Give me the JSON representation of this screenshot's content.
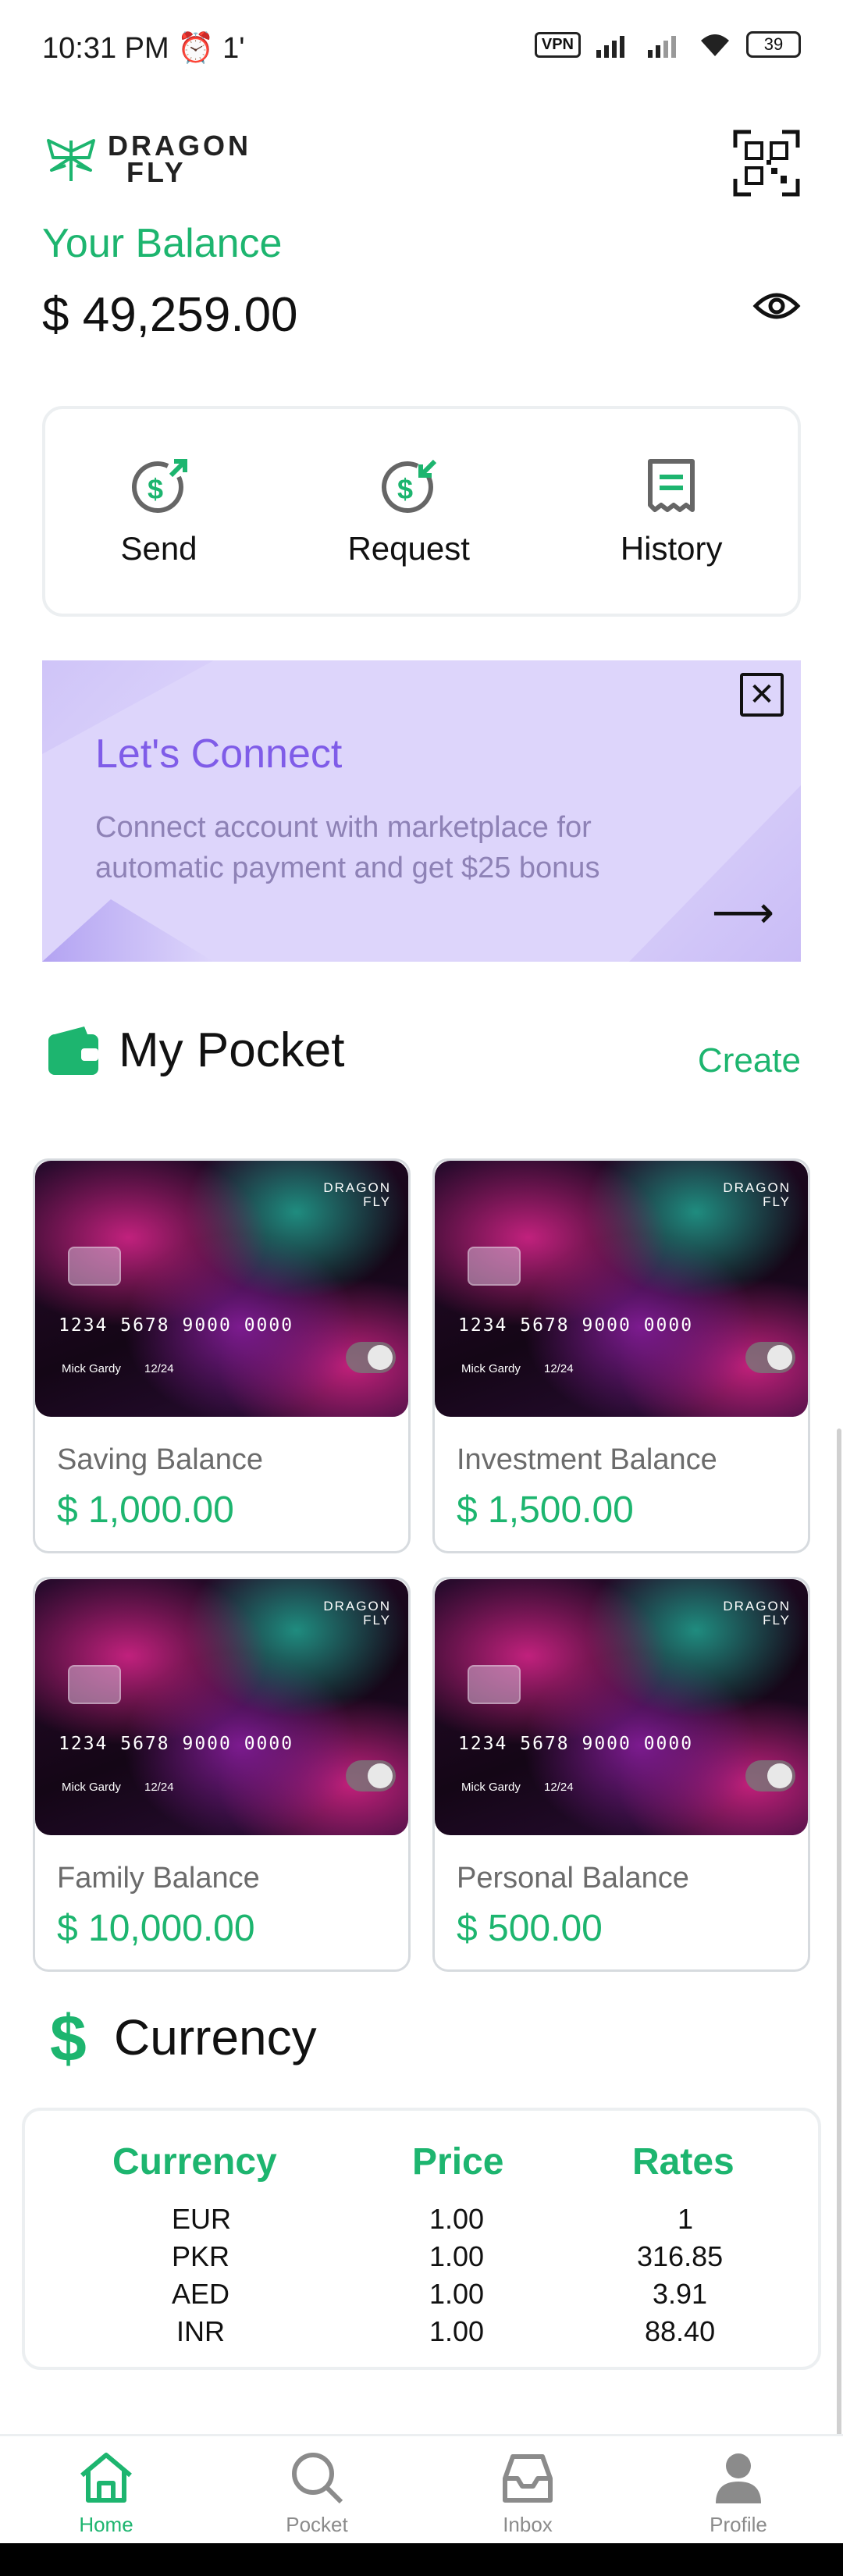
{
  "status": {
    "time": "10:31 PM",
    "extra": "1'",
    "vpn": "VPN",
    "battery": "39"
  },
  "brand": {
    "line1": "DRAGON",
    "line2": "FLY"
  },
  "balance": {
    "label": "Your Balance",
    "amount": "$ 49,259.00"
  },
  "actions": [
    {
      "label": "Send",
      "icon": "send-money-icon"
    },
    {
      "label": "Request",
      "icon": "request-money-icon"
    },
    {
      "label": "History",
      "icon": "receipt-icon"
    }
  ],
  "promo": {
    "title": "Let's Connect",
    "body": "Connect account with marketplace for automatic payment and get $25 bonus"
  },
  "pocket": {
    "title": "My Pocket",
    "create": "Create",
    "cards": [
      {
        "name": "Saving Balance",
        "amount": "$ 1,000.00"
      },
      {
        "name": "Investment Balance",
        "amount": "$ 1,500.00"
      },
      {
        "name": "Family Balance",
        "amount": "$ 10,000.00"
      },
      {
        "name": "Personal Balance",
        "amount": "$ 500.00"
      }
    ],
    "card_face": {
      "brand1": "DRAGON",
      "brand2": "FLY",
      "number": "1234 5678 9000 0000",
      "holder": "Mick Gardy",
      "expiry": "12/24"
    }
  },
  "currency": {
    "title": "Currency",
    "headers": [
      "Currency",
      "Price",
      "Rates"
    ],
    "rows": [
      [
        "EUR",
        "1.00",
        "1"
      ],
      [
        "PKR",
        "1.00",
        "316.85"
      ],
      [
        "AED",
        "1.00",
        "3.91"
      ],
      [
        "INR",
        "1.00",
        "88.40"
      ]
    ]
  },
  "nav": [
    {
      "label": "Home",
      "icon": "home-icon",
      "active": true
    },
    {
      "label": "Pocket",
      "icon": "search-icon",
      "active": false
    },
    {
      "label": "Inbox",
      "icon": "inbox-icon",
      "active": false
    },
    {
      "label": "Profile",
      "icon": "profile-icon",
      "active": false
    }
  ],
  "colors": {
    "accent": "#1db56f",
    "promo_bg": "#ddd5fb",
    "promo_title": "#7f5ce8"
  }
}
